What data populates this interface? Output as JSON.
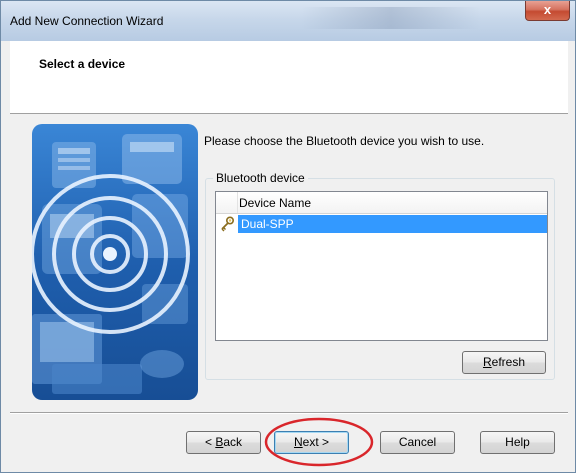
{
  "window": {
    "title": "Add New Connection Wizard",
    "close_glyph": "x"
  },
  "header": {
    "title": "Select a device"
  },
  "content": {
    "instruction": "Please choose the Bluetooth device you wish to use.",
    "group_label": "Bluetooth device",
    "list": {
      "column_header": "Device Name",
      "rows": [
        {
          "name": "Dual-SPP",
          "icon": "bluetooth-key-icon",
          "selected": true
        }
      ]
    },
    "refresh": {
      "accel": "R",
      "rest": "efresh"
    }
  },
  "footer": {
    "back": {
      "prefix": "< ",
      "accel": "B",
      "rest": "ack"
    },
    "next": {
      "accel": "N",
      "rest": "ext >"
    },
    "cancel": "Cancel",
    "help": "Help"
  },
  "colors": {
    "selection": "#3399ff",
    "highlight_ring": "#d9262b",
    "art_blue": "#1f5fae"
  }
}
